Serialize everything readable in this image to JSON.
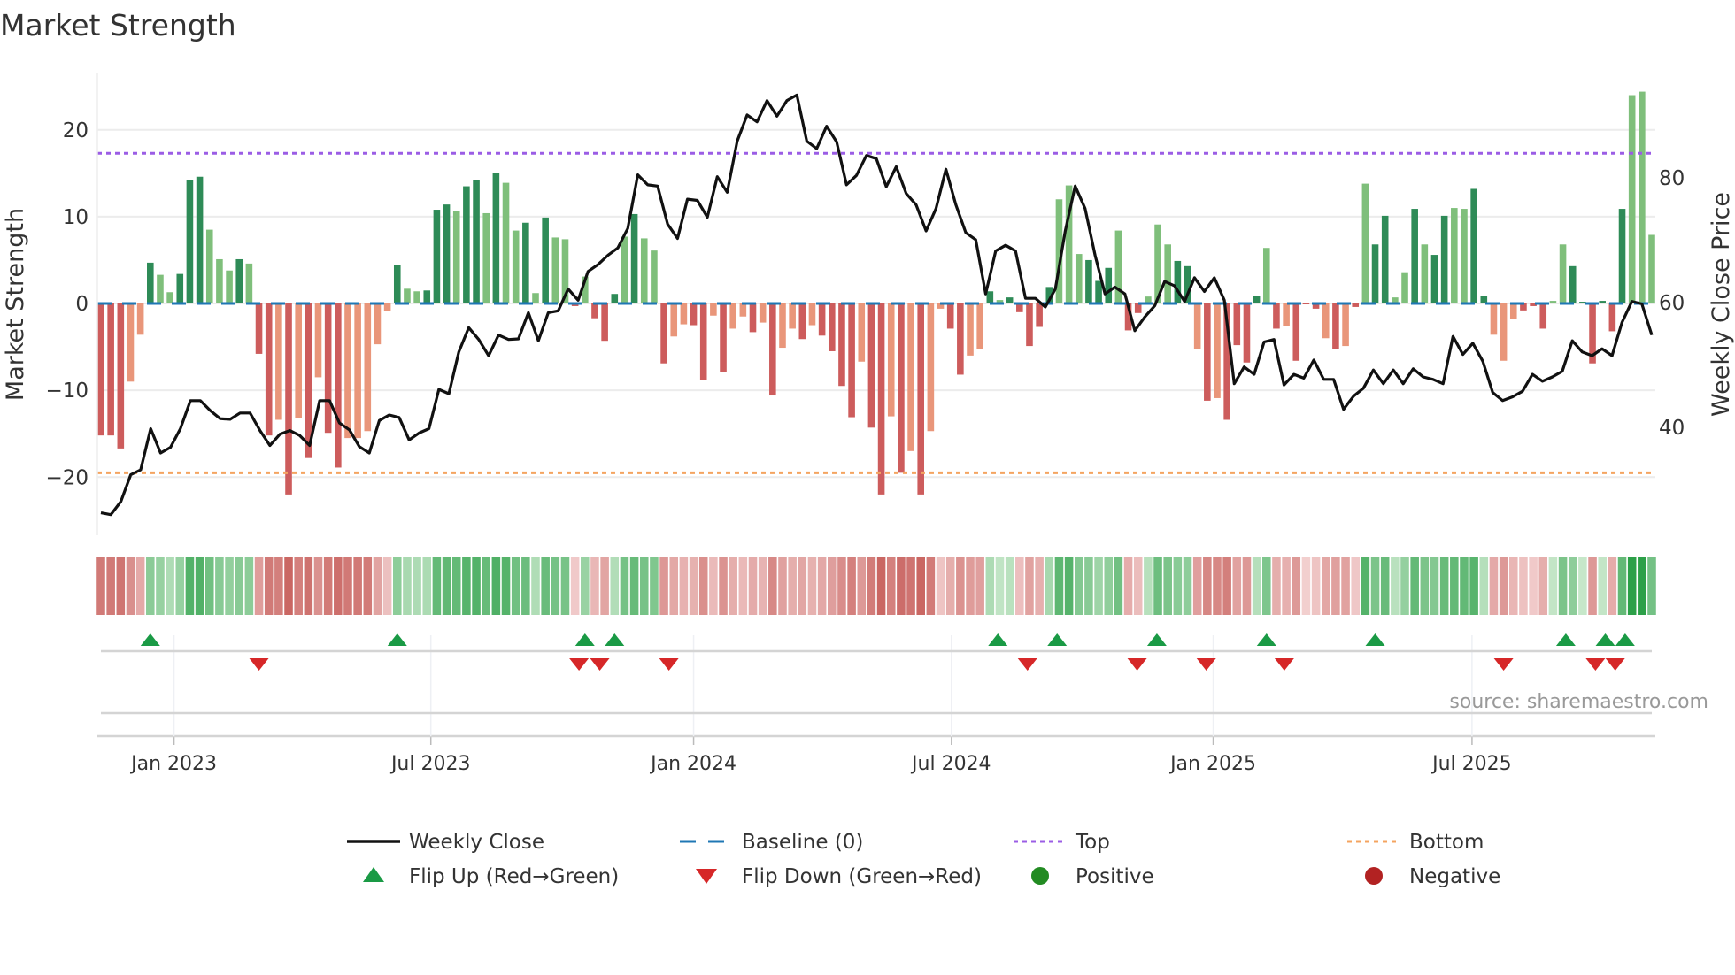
{
  "chart_data": {
    "type": "bar",
    "title": "Market Strength",
    "ylabel": "Market Strength",
    "y2label": "Weekly Close Price",
    "ylim": [
      -26.7,
      26.6
    ],
    "y2lim": [
      22.7,
      96.9
    ],
    "yticks": [
      20,
      10,
      0,
      -10,
      -20
    ],
    "ytick_labels": [
      "20",
      "10",
      "0",
      "−10",
      "−20"
    ],
    "y2ticks": [
      80,
      60,
      40
    ],
    "y2tick_labels": [
      "80",
      "60",
      "40"
    ],
    "xticks": [
      {
        "x": 7.4,
        "label": "Jan 2023"
      },
      {
        "x": 33.4,
        "label": "Jul 2023"
      },
      {
        "x": 60.0,
        "label": "Jan 2024"
      },
      {
        "x": 86.1,
        "label": "Jul 2024"
      },
      {
        "x": 112.6,
        "label": "Jan 2025"
      },
      {
        "x": 138.8,
        "label": "Jul 2025"
      }
    ],
    "x_unit": "week index",
    "top_level": 17.3,
    "bottom_level": -19.5,
    "baseline": 0,
    "strength": [
      -15.2,
      -15.2,
      -16.7,
      -9,
      -3.6,
      4.7,
      3.3,
      1.3,
      3.4,
      14.2,
      14.6,
      8.5,
      5.1,
      3.8,
      5.1,
      4.6,
      -5.8,
      -15.2,
      -13.4,
      -22,
      -13.2,
      -17.8,
      -8.5,
      -14.9,
      -18.9,
      -15.5,
      -15.5,
      -14.7,
      -4.7,
      -0.9,
      4.4,
      1.7,
      1.4,
      1.5,
      10.8,
      11.4,
      10.7,
      13.5,
      14.2,
      10.4,
      15.0,
      13.9,
      8.4,
      9.3,
      1.2,
      9.9,
      7.6,
      7.4,
      -0.3,
      3.1,
      -1.7,
      -4.3,
      1.1,
      7.7,
      10.3,
      7.5,
      6.1,
      -6.9,
      -3.8,
      -2.4,
      -2.5,
      -8.8,
      -1.4,
      -7.9,
      -2.9,
      -1.5,
      -3.3,
      -2.2,
      -10.6,
      -5.1,
      -2.9,
      -4.1,
      -2.5,
      -3.7,
      -5.5,
      -9.5,
      -13.1,
      -6.7,
      -14.3,
      -22,
      -13,
      -19.5,
      -17,
      -22,
      -14.7,
      -0.6,
      -2.9,
      -8.2,
      -6,
      -5.3,
      1.4,
      0.4,
      0.7,
      -1,
      -4.9,
      -2.7,
      1.9,
      12,
      13.6,
      5.7,
      5,
      2.6,
      4.1,
      8.4,
      -3.1,
      -1.1,
      0.8,
      9.1,
      6.8,
      4.9,
      4.3,
      -5.3,
      -11.2,
      -10.9,
      -13.4,
      -4.8,
      -6.8,
      0.9,
      6.4,
      -2.9,
      -2.6,
      -6.6,
      -0.1,
      -0.6,
      -4,
      -5.2,
      -4.9,
      -0.4,
      13.8,
      6.8,
      10.1,
      0.7,
      3.6,
      10.9,
      6.8,
      5.6,
      10.1,
      11,
      10.9,
      13.2,
      0.9,
      -3.6,
      -6.6,
      -1.8,
      -0.8,
      -0.3,
      -2.9,
      0.3,
      6.8,
      4.3,
      0.2,
      -6.9,
      0.3,
      -3.2,
      10.9,
      24,
      24.4,
      7.9
    ],
    "strength_shade": "DDDLLDLLDDDLLLDLDDLDLDLDDLLLLLDLLDDDLDDLDLLDLDLLDLDDDLDLLDLLDDLDLLDLDLLDLDDDDLDDLDLDLLDDLLDLDDDDDLLLDDDLDDLLLDDLDLDDDDLDLDDDLDLDLDDLLDLDDLLDDLLLDDDLLDDDDDDL",
    "weekly_close": [
      26.3,
      26,
      28.1,
      32.4,
      33.2,
      39.8,
      35.9,
      36.8,
      39.8,
      44.3,
      44.3,
      42.7,
      41.4,
      41.3,
      42.3,
      42.3,
      39.5,
      37.1,
      38.9,
      39.5,
      38.7,
      37.1,
      44.3,
      44.3,
      40.7,
      39.6,
      36.9,
      35.9,
      41.1,
      42,
      41.6,
      38,
      39.1,
      39.8,
      46.1,
      45.4,
      52.1,
      56,
      54.1,
      51.5,
      54.8,
      54.1,
      54.2,
      58.4,
      53.9,
      58.4,
      58.7,
      62.2,
      60.4,
      65,
      66.1,
      67.6,
      68.8,
      71.9,
      80.5,
      78.9,
      78.7,
      72.6,
      70.3,
      76.6,
      76.4,
      73.7,
      80.2,
      77.7,
      85.9,
      90.1,
      89,
      92.4,
      89.9,
      92.4,
      93.3,
      85.9,
      84.7,
      88.3,
      85.8,
      78.9,
      80.4,
      83.6,
      83.1,
      78.6,
      81.8,
      77.5,
      75.7,
      71.5,
      75.1,
      81.4,
      75.7,
      71.2,
      70.1,
      61.4,
      68.3,
      69.2,
      68.3,
      60.7,
      60.7,
      59.3,
      62.2,
      71.5,
      78.7,
      75.1,
      67.6,
      61.4,
      62.5,
      61.4,
      55.5,
      57.7,
      59.5,
      63.4,
      62.7,
      60.2,
      64,
      61.8,
      64,
      60.4,
      47,
      49.7,
      48.5,
      53.7,
      54.1,
      46.8,
      48.5,
      47.9,
      50.8,
      47.7,
      47.7,
      42.9,
      45,
      46.3,
      49.2,
      47,
      49.2,
      47,
      49.4,
      48.1,
      47.7,
      47,
      54.6,
      51.7,
      53.5,
      50.6,
      45.6,
      44.3,
      44.9,
      45.8,
      48.5,
      47.4,
      48.1,
      49,
      53.9,
      52.1,
      51.5,
      52.6,
      51.5,
      56.8,
      60.2,
      59.8,
      54.8
    ],
    "flip_up": [
      5,
      30,
      49,
      52,
      90.8,
      96.8,
      106.9,
      118,
      129,
      148.3,
      152.3,
      154.3
    ],
    "flip_down": [
      16,
      48.4,
      50.5,
      57.5,
      93.8,
      104.9,
      111.9,
      119.8,
      142,
      151.3,
      153.3
    ],
    "legend": [
      {
        "label": "Weekly Close",
        "kind": "line"
      },
      {
        "label": "Baseline (0)",
        "kind": "dash"
      },
      {
        "label": "Top",
        "kind": "dot-top"
      },
      {
        "label": "Bottom",
        "kind": "dot-bottom"
      },
      {
        "label": "Flip Up (Red→Green)",
        "kind": "tri-up"
      },
      {
        "label": "Flip Down (Green→Red)",
        "kind": "tri-down"
      },
      {
        "label": "Positive",
        "kind": "circle-pos"
      },
      {
        "label": "Negative",
        "kind": "circle-neg"
      }
    ],
    "legend_position": "bottom",
    "source": "source: sharemaestro.com"
  },
  "colors": {
    "pos_strong": "#2e8b57",
    "pos_weak": "#7fbf7b",
    "neg_strong": "#cd5c5c",
    "neg_weak": "#e9967a",
    "baseline": "#1f77b4",
    "top": "#9b5de5",
    "bottom": "#f4a460",
    "close": "#111111",
    "flip_up": "#1a9a45",
    "flip_down": "#d62728",
    "positive": "#228b22",
    "negative": "#b22222"
  }
}
